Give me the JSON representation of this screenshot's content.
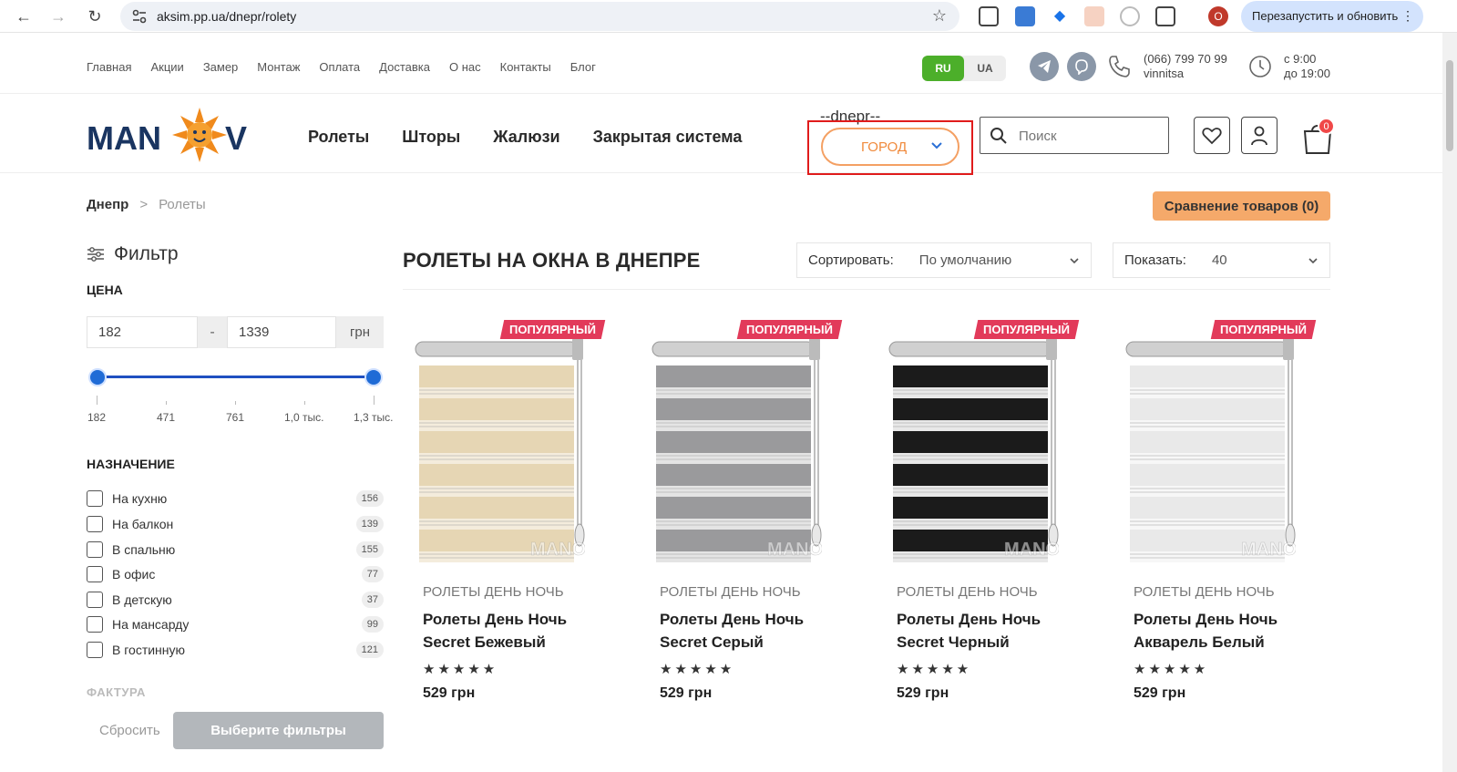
{
  "browser": {
    "url": "aksim.pp.ua/dnepr/rolety",
    "restart_label": "Перезапустить и обновить",
    "profile_initial": "O"
  },
  "topnav": [
    "Главная",
    "Акции",
    "Замер",
    "Монтаж",
    "Оплата",
    "Доставка",
    "О нас",
    "Контакты",
    "Блог"
  ],
  "lang": {
    "ru": "RU",
    "ua": "UA",
    "active": "RU"
  },
  "contacts": {
    "phone": "(066) 799 70 99",
    "city": "vinnitsa",
    "hours_from": "с 9:00",
    "hours_to": "до 19:00"
  },
  "header": {
    "main_nav": [
      "Ролеты",
      "Шторы",
      "Жалюзи",
      "Закрытая система"
    ],
    "city_label": "--dnepr--",
    "city_select": "ГОРОД",
    "search_placeholder": "Поиск",
    "cart_count": "0"
  },
  "breadcrumb": {
    "home": "Днепр",
    "separator": ">",
    "current": "Ролеты"
  },
  "compare_label": "Сравнение товаров (0)",
  "filter": {
    "title": "Фильтр",
    "price_title": "ЦЕНА",
    "price_min": "182",
    "price_max": "1339",
    "price_dash": "-",
    "currency": "грн",
    "tick_labels": [
      "182",
      "471",
      "761",
      "1,0 тыс.",
      "1,3 тыс."
    ],
    "purpose_title": "НАЗНАЧЕНИЕ",
    "purpose": [
      {
        "label": "На кухню",
        "count": "156"
      },
      {
        "label": "На балкон",
        "count": "139"
      },
      {
        "label": "В спальню",
        "count": "155"
      },
      {
        "label": "В офис",
        "count": "77"
      },
      {
        "label": "В детскую",
        "count": "37"
      },
      {
        "label": "На мансарду",
        "count": "99"
      },
      {
        "label": "В гостинную",
        "count": "121"
      }
    ],
    "texture_title": "ФАКТУРА",
    "reset_label": "Сбросить",
    "apply_label": "Выберите фильтры"
  },
  "catalog": {
    "title": "РОЛЕТЫ НА ОКНА В ДНЕПРЕ",
    "sort_label": "Сортировать:",
    "sort_value": "По умолчанию",
    "show_label": "Показать:",
    "show_value": "40",
    "products": [
      {
        "badge": "ПОПУЛЯРНЫЙ",
        "category": "РОЛЕТЫ ДЕНЬ НОЧЬ",
        "name": "Ролеты День Ночь Secret Бежевый",
        "price": "529 грн",
        "rating": 5,
        "color": "#e6d6b4",
        "stripe": "#f4ecdc"
      },
      {
        "badge": "ПОПУЛЯРНЫЙ",
        "category": "РОЛЕТЫ ДЕНЬ НОЧЬ",
        "name": "Ролеты День Ночь Secret Серый",
        "price": "529 грн",
        "rating": 5,
        "color": "#9a9a9c",
        "stripe": "#e4e4e4"
      },
      {
        "badge": "ПОПУЛЯРНЫЙ",
        "category": "РОЛЕТЫ ДЕНЬ НОЧЬ",
        "name": "Ролеты День Ночь Secret Черный",
        "price": "529 грн",
        "rating": 5,
        "color": "#1b1b1b",
        "stripe": "#e8e8e8"
      },
      {
        "badge": "ПОПУЛЯРНЫЙ",
        "category": "РОЛЕТЫ ДЕНЬ НОЧЬ",
        "name": "Ролеты День Ночь Акварель Белый",
        "price": "529 грн",
        "rating": 5,
        "color": "#e9e9e9",
        "stripe": "#f7f7f7"
      }
    ],
    "watermark": "MANOV"
  },
  "logo_text": {
    "left": "MAN",
    "right": "V"
  },
  "colors": {
    "accent": "#f5a96a",
    "brand_blue": "#1a3561",
    "badge": "#e23a5a",
    "highlight": "#e01b1b"
  }
}
